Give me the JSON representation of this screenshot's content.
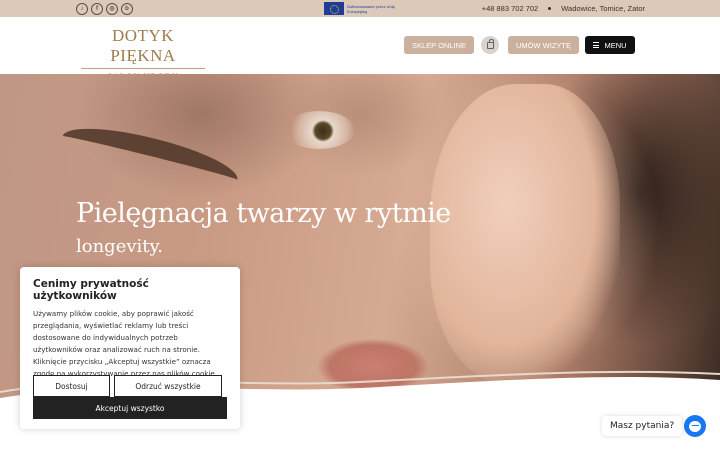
{
  "topbar": {
    "social_icons": [
      {
        "name": "tiktok-icon",
        "glyph": "♪"
      },
      {
        "name": "facebook-icon",
        "glyph": "f"
      },
      {
        "name": "instagram-icon",
        "glyph": "◎"
      },
      {
        "name": "booksy-icon",
        "glyph": "b"
      }
    ],
    "eu_text": "Dofinansowane przez Unię Europejską",
    "phone": "+48 883 702 702",
    "locations": "Wadowice, Tomice, Zator"
  },
  "header": {
    "logo_title": "DOTYK PIĘKNA",
    "logo_subtitle": "SALON URODY",
    "shop_label": "SKLEP ONLINE",
    "book_label": "UMÓW WIZYTĘ",
    "menu_label": "MENU"
  },
  "hero": {
    "title": "Pielęgnacja twarzy w rytmie",
    "subtitle": "longevity."
  },
  "cookie": {
    "title": "Cenimy prywatność użytkowników",
    "text": "Używamy plików cookie, aby poprawić jakość przeglądania, wyświetlać reklamy lub treści dostosowane do indywidualnych potrzeb użytkowników oraz analizować ruch na stronie. Kliknięcie przycisku „Akceptuj wszystkie” oznacza zgodę na wykorzystywanie przez nas plików cookie.",
    "customize_label": "Dostosuj",
    "reject_label": "Odrzuć wszystkie",
    "accept_label": "Akceptuj wszystko"
  },
  "chat": {
    "label": "Masz pytania?"
  },
  "colors": {
    "topbar": "#dcc9b9",
    "brand_gold": "#9d7d4e",
    "button_beige": "#cbb09d",
    "messenger_blue": "#1877f2"
  }
}
